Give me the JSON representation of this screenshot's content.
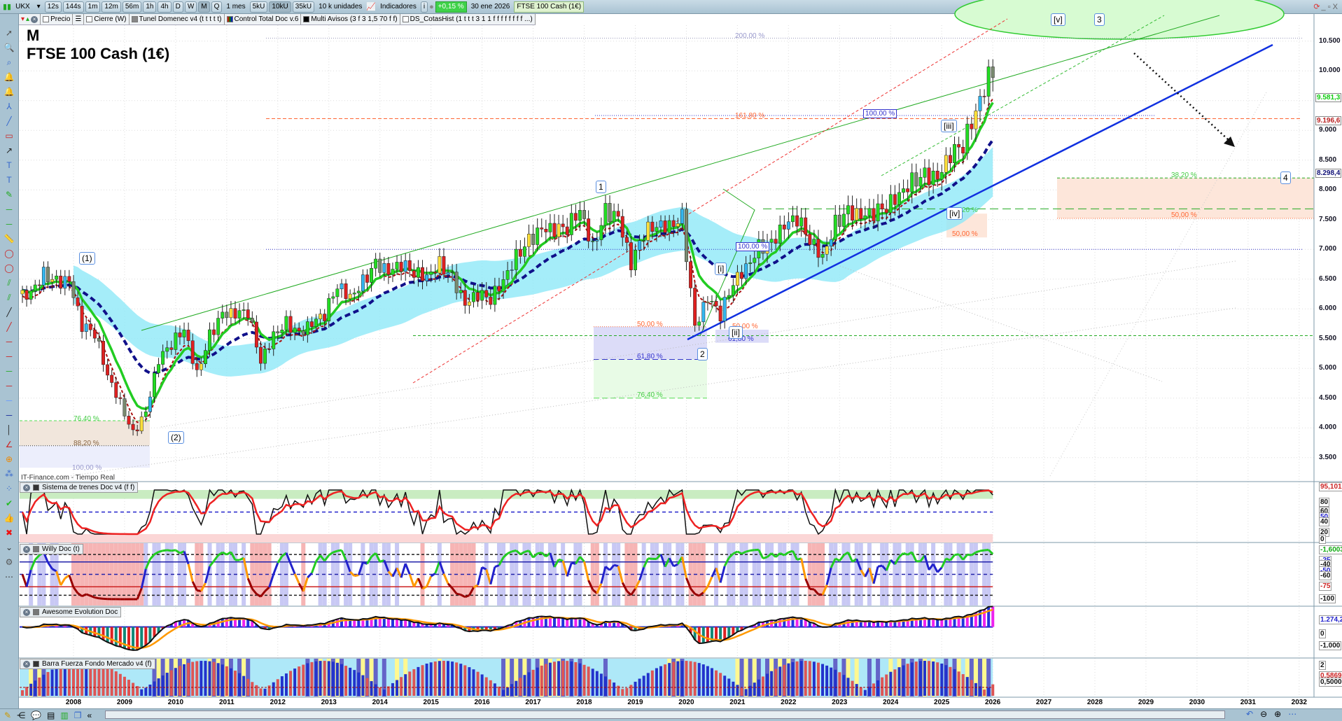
{
  "toolbar": {
    "symbol": "UKX",
    "intervals": [
      "12s",
      "144s",
      "1m",
      "12m",
      "56m",
      "1h",
      "4h",
      "D",
      "W",
      "M",
      "Q"
    ],
    "active_interval": "M",
    "range": "1 mes",
    "units": [
      "5kU",
      "10kU",
      "35kU"
    ],
    "active_unit": "10kU",
    "units_select": "10 k unidades",
    "indicators": "Indicadores",
    "change": "+0,15 %",
    "date": "30 ene 2026",
    "instrument": "FTSE 100 Cash (1€)"
  },
  "legend": [
    "Precio",
    "Cierre (W)",
    "Tunel Domenec v4 (t t t t t)",
    "Control Total Doc v.6",
    "Multi Avisos (3 f 3 1,5 70 f f)",
    "DS_CotasHist (1 t t t 3 1 1 f f f f f f f f ...)"
  ],
  "title": {
    "period": "M",
    "name": "FTSE 100 Cash (1€)"
  },
  "source": "IT-Finance.com - Tiempo Real",
  "price_axis": [
    "10.500",
    "10.000",
    "9.500",
    "9.000",
    "8.500",
    "8.000",
    "7.500",
    "7.000",
    "6.500",
    "6.000",
    "5.500",
    "5.000",
    "4.500",
    "4.000",
    "3.500"
  ],
  "price_tags": {
    "ema": "9.581,3",
    "level": "9.196,6",
    "ma": "8.298,4"
  },
  "colors": {
    "up": "#22dd22",
    "down": "#e02020",
    "ma_fast": "#22cc22",
    "ma_slow": "#10108a",
    "band": "#8fe8f8",
    "trend": "#1030e0"
  },
  "fib_labels": [
    "200,00 %",
    "161,80 %",
    "100,00 %",
    "100,00 %",
    "50,00 %",
    "61,80 %",
    "76,40 %",
    "76,40 %",
    "88,20 %",
    "100,00 %",
    "38,20 %",
    "50,00 %",
    "38,20 %",
    "50,00 %",
    "50,00 %",
    "61,80 %"
  ],
  "waves": [
    "(1)",
    "(2)",
    "1",
    "2",
    "[i]",
    "[ii]",
    "[iii]",
    "[iv]",
    "[v]",
    "3",
    "4"
  ],
  "panels": [
    {
      "name": "Sistema de trenes Doc v4 (f f)",
      "axis": [
        "95,101",
        "80",
        "60",
        "50",
        "40",
        "20",
        "0"
      ]
    },
    {
      "name": "Willy Doc (t)",
      "axis": [
        "-1,6003",
        "-25",
        "-40",
        "-50",
        "-60",
        "-75",
        "-100"
      ]
    },
    {
      "name": "Awesome Evolution Doc",
      "axis": [
        "1.274,2",
        "0",
        "-1.000"
      ]
    },
    {
      "name": "Barra Fuerza Fondo Mercado v4 (f)",
      "axis": [
        "2",
        "0,5869",
        "0,5000"
      ]
    }
  ],
  "years": [
    "2008",
    "2009",
    "2010",
    "2011",
    "2012",
    "2013",
    "2014",
    "2015",
    "2016",
    "2017",
    "2018",
    "2019",
    "2020",
    "2021",
    "2022",
    "2023",
    "2024",
    "2025",
    "2026",
    "2027",
    "2028",
    "2029",
    "2030",
    "2031",
    "2032"
  ],
  "chart_data": {
    "type": "candlestick",
    "title": "FTSE 100 Cash (1€)",
    "xlabel": "",
    "ylabel": "",
    "ylim": [
      3300,
      10700
    ],
    "xlim": [
      2007,
      2032.3
    ],
    "frequency": "quarterly close (approx.)",
    "start": "2007-Q1",
    "closes": [
      6300,
      6600,
      6450,
      6450,
      5700,
      5600,
      4900,
      4430,
      3900,
      4250,
      5130,
      5410,
      5680,
      4920,
      5550,
      5900,
      5900,
      5950,
      5130,
      5570,
      5770,
      5570,
      5740,
      5900,
      6410,
      6215,
      6460,
      6750,
      6600,
      6740,
      6620,
      6560,
      6770,
      6520,
      6060,
      6240,
      6170,
      6500,
      6900,
      7140,
      7320,
      7310,
      7370,
      7690,
      7050,
      7640,
      7510,
      6730,
      7280,
      7425,
      7410,
      7540,
      5670,
      6170,
      5900,
      6460,
      6710,
      7040,
      7090,
      7380,
      7520,
      7170,
      6890,
      7450,
      7630,
      7530,
      7600,
      7730,
      7950,
      8160,
      8240,
      8170,
      8580,
      8760,
      9350,
      9930,
      10200
    ]
  }
}
